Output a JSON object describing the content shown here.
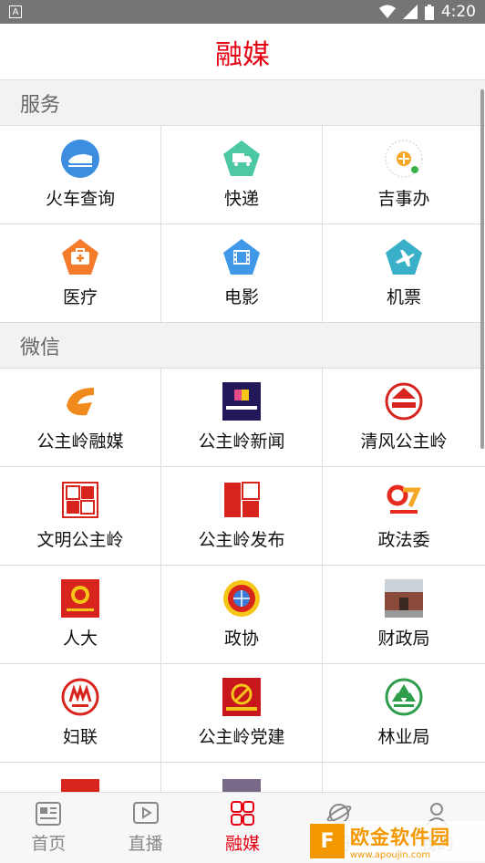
{
  "status": {
    "time": "4:20",
    "notif": "A"
  },
  "header": {
    "title": "融媒"
  },
  "services": {
    "title": "服务",
    "items": [
      {
        "label": "火车查询",
        "icon": "train-icon"
      },
      {
        "label": "快递",
        "icon": "truck-icon"
      },
      {
        "label": "吉事办",
        "icon": "qr-code-icon"
      },
      {
        "label": "医疗",
        "icon": "medical-kit-icon"
      },
      {
        "label": "电影",
        "icon": "film-icon"
      },
      {
        "label": "机票",
        "icon": "plane-icon"
      }
    ]
  },
  "wechat": {
    "title": "微信",
    "items": [
      {
        "label": "公主岭融媒",
        "icon": "rongmei-logo-icon"
      },
      {
        "label": "公主岭新闻",
        "icon": "news-logo-icon"
      },
      {
        "label": "清风公主岭",
        "icon": "qingfeng-logo-icon"
      },
      {
        "label": "文明公主岭",
        "icon": "wenming-logo-icon"
      },
      {
        "label": "公主岭发布",
        "icon": "fabu-logo-icon"
      },
      {
        "label": "政法委",
        "icon": "zhengfa-logo-icon"
      },
      {
        "label": "人大",
        "icon": "renda-logo-icon"
      },
      {
        "label": "政协",
        "icon": "zhengxie-logo-icon"
      },
      {
        "label": "财政局",
        "icon": "caizheng-photo-icon"
      },
      {
        "label": "妇联",
        "icon": "fulian-logo-icon"
      },
      {
        "label": "公主岭党建",
        "icon": "dangjian-logo-icon"
      },
      {
        "label": "林业局",
        "icon": "linye-logo-icon"
      }
    ]
  },
  "tabs": [
    {
      "label": "首页"
    },
    {
      "label": "直播"
    },
    {
      "label": "融媒"
    },
    {
      "label": "圈子"
    },
    {
      "label": "我的"
    }
  ],
  "watermark": {
    "text": "欧金软件园",
    "sub": "www.apoujin.com"
  },
  "colors": {
    "accent": "#e60012",
    "statusbar": "#757575"
  }
}
